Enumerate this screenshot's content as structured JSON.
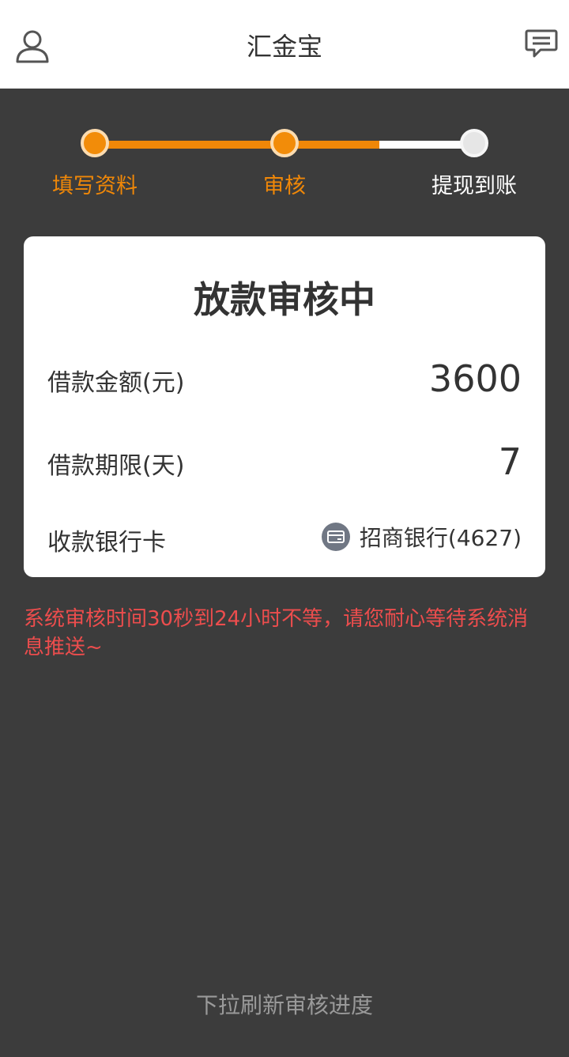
{
  "header": {
    "title": "汇金宝",
    "left_icon": "user-icon",
    "right_icon": "message-icon"
  },
  "steps": [
    {
      "label": "填写资料",
      "state": "done"
    },
    {
      "label": "审核",
      "state": "current"
    },
    {
      "label": "提现到账",
      "state": "pending"
    }
  ],
  "card": {
    "title": "放款审核中",
    "amount_label": "借款金额(元)",
    "amount_value": "3600",
    "term_label": "借款期限(天)",
    "term_value": "7",
    "bank_label": "收款银行卡",
    "bank_icon": "bank-card-icon",
    "bank_value": "招商银行(4627)"
  },
  "notice": "系统审核时间30秒到24小时不等，请您耐心等待系统消息推送~",
  "footer_hint": "下拉刷新审核进度",
  "colors": {
    "accent": "#ef8708",
    "background": "#3c3c3c",
    "notice": "#ec4d4d"
  }
}
